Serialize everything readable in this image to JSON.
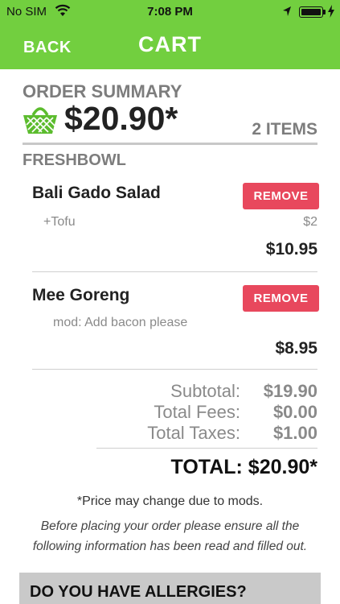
{
  "status_bar": {
    "carrier": "No SIM",
    "time": "7:08 PM",
    "icons": [
      "wifi-icon",
      "location-arrow-icon",
      "battery-icon",
      "charging-icon"
    ]
  },
  "header": {
    "back_label": "BACK",
    "title": "CART",
    "background_color": "#72cf3f"
  },
  "summary": {
    "label": "ORDER SUMMARY",
    "total": "$20.90*",
    "item_count": "2 ITEMS",
    "icon": "basket-icon"
  },
  "vendor": "FRESHBOWL",
  "items": [
    {
      "name": "Bali Gado Salad",
      "remove_label": "REMOVE",
      "mod": "+Tofu",
      "mod_price": "$2",
      "price": "$10.95"
    },
    {
      "name": "Mee Goreng",
      "remove_label": "REMOVE",
      "mod": "mod: Add bacon please",
      "price": "$8.95"
    }
  ],
  "totals": {
    "subtotal_label": "Subtotal:",
    "subtotal": "$19.90",
    "fees_label": "Total Fees:",
    "fees": "$0.00",
    "taxes_label": "Total Taxes:",
    "taxes": "$1.00",
    "grand_total": "TOTAL: $20.90*"
  },
  "notes": {
    "price_note": "*Price may change due to mods.",
    "disclaimer": "Before placing your order please ensure all the following information has been read and filled out."
  },
  "allergies": {
    "heading": "DO YOU HAVE ALLERGIES?"
  },
  "colors": {
    "accent": "#72cf3f",
    "remove": "#e8485d",
    "muted": "#7d7d7d"
  }
}
